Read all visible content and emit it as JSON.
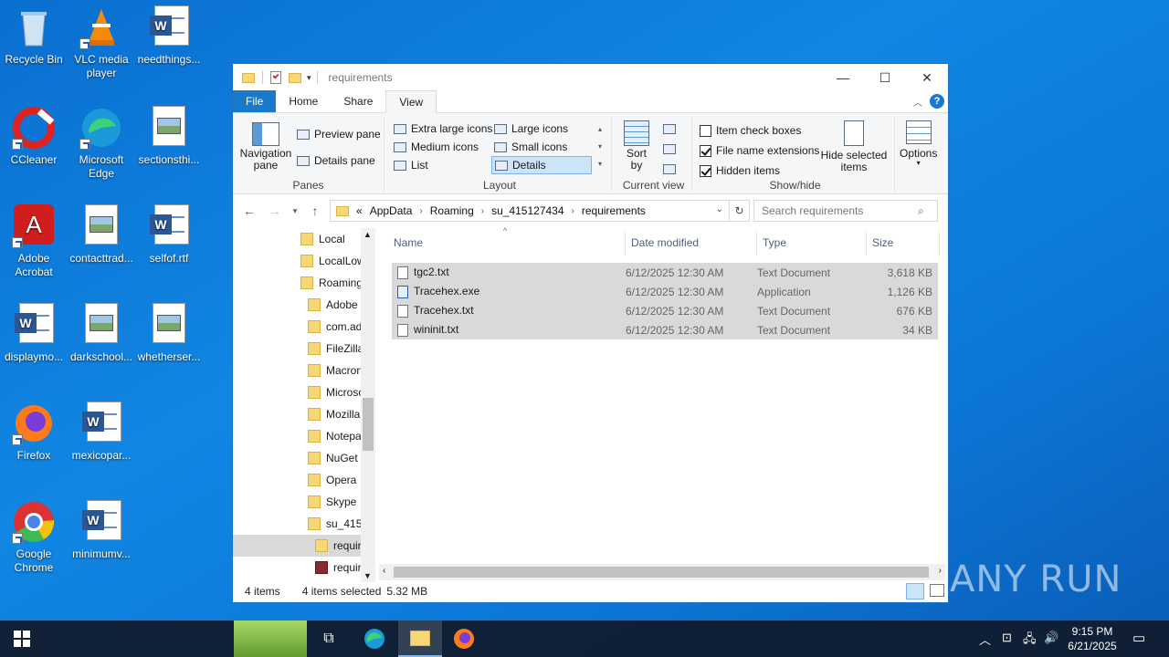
{
  "desktop": {
    "icons": [
      {
        "label": "Recycle Bin"
      },
      {
        "label": "VLC media player"
      },
      {
        "label": "needthings..."
      },
      {
        "label": "CCleaner"
      },
      {
        "label": "Microsoft Edge"
      },
      {
        "label": "sectionsthi..."
      },
      {
        "label": "Adobe Acrobat"
      },
      {
        "label": "contacttrad..."
      },
      {
        "label": "selfof.rtf"
      },
      {
        "label": "displaymo..."
      },
      {
        "label": "darkschool..."
      },
      {
        "label": "whetherser..."
      },
      {
        "label": "Firefox"
      },
      {
        "label": "mexicopar..."
      },
      {
        "label": "Google Chrome"
      },
      {
        "label": "minimumv..."
      }
    ]
  },
  "window": {
    "title": "requirements",
    "controls": {
      "minimize": "—",
      "maximize": "☐",
      "close": "✕"
    },
    "tabs": [
      "File",
      "Home",
      "Share",
      "View"
    ],
    "ribbon": {
      "panes": {
        "navigation_pane": "Navigation pane",
        "preview_pane": "Preview pane",
        "details_pane": "Details pane",
        "label": "Panes"
      },
      "layout": {
        "options": [
          "Extra large icons",
          "Large icons",
          "Medium icons",
          "Small icons",
          "List",
          "Details"
        ],
        "selected": "Details",
        "label": "Layout"
      },
      "current_view": {
        "sort_by": "Sort by",
        "label": "Current view"
      },
      "show_hide": {
        "item_check_boxes": "Item check boxes",
        "item_check_boxes_checked": false,
        "file_name_extensions": "File name extensions",
        "file_name_extensions_checked": true,
        "hidden_items": "Hidden items",
        "hidden_items_checked": true,
        "hide_selected_items": "Hide selected items",
        "label": "Show/hide"
      },
      "options": "Options"
    },
    "address": {
      "prefix": "«",
      "crumbs": [
        "AppData",
        "Roaming",
        "su_415127434",
        "requirements"
      ]
    },
    "search_placeholder": "Search requirements",
    "nav_items": [
      "Local",
      "LocalLow",
      "Roaming",
      "Adobe",
      "com.ad",
      "FileZilla",
      "Macron",
      "Microsc",
      "Mozilla",
      "Notepa",
      "NuGet",
      "Opera",
      "Skype",
      "su_415",
      "requir",
      "requir"
    ],
    "columns": [
      "Name",
      "Date modified",
      "Type",
      "Size"
    ],
    "files": [
      {
        "name": "tgc2.txt",
        "date": "6/12/2025 12:30 AM",
        "type": "Text Document",
        "size": "3,618 KB"
      },
      {
        "name": "Tracehex.exe",
        "date": "6/12/2025 12:30 AM",
        "type": "Application",
        "size": "1,126 KB"
      },
      {
        "name": "Tracehex.txt",
        "date": "6/12/2025 12:30 AM",
        "type": "Text Document",
        "size": "676 KB"
      },
      {
        "name": "wininit.txt",
        "date": "6/12/2025 12:30 AM",
        "type": "Text Document",
        "size": "34 KB"
      }
    ],
    "status": {
      "items": "4 items",
      "selected": "4 items selected",
      "size": "5.32 MB"
    }
  },
  "taskbar": {
    "time": "9:15 PM",
    "date": "6/21/2025"
  },
  "watermark": "ANY RUN"
}
